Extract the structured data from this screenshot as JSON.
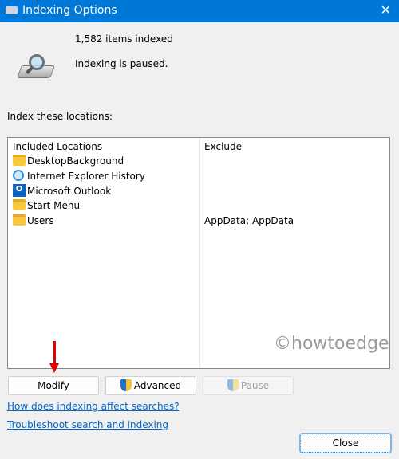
{
  "window": {
    "title": "Indexing Options",
    "close_glyph": "✕",
    "title_icon": "indexing-drive-icon"
  },
  "status": {
    "items_indexed": "1,582 items indexed",
    "state": "Indexing is paused."
  },
  "locations_label": "Index these locations:",
  "table": {
    "headers": {
      "included": "Included Locations",
      "exclude": "Exclude"
    },
    "rows": [
      {
        "name": "DesktopBackground",
        "exclude": "",
        "icon": "folder-icon"
      },
      {
        "name": "Internet Explorer History",
        "exclude": "",
        "icon": "internet-explorer-icon"
      },
      {
        "name": "Microsoft Outlook",
        "exclude": "",
        "icon": "outlook-icon"
      },
      {
        "name": "Start Menu",
        "exclude": "",
        "icon": "folder-icon"
      },
      {
        "name": "Users",
        "exclude": "AppData; AppData",
        "icon": "folder-icon"
      }
    ]
  },
  "watermark": "©howtoedge",
  "buttons": {
    "modify": "Modify",
    "advanced": "Advanced",
    "pause": "Pause",
    "close": "Close"
  },
  "links": {
    "how": "How does indexing affect searches?",
    "troubleshoot": "Troubleshoot search and indexing"
  },
  "colors": {
    "titlebar": "#0078d7",
    "link": "#0066cc",
    "arrow": "#e00000"
  }
}
